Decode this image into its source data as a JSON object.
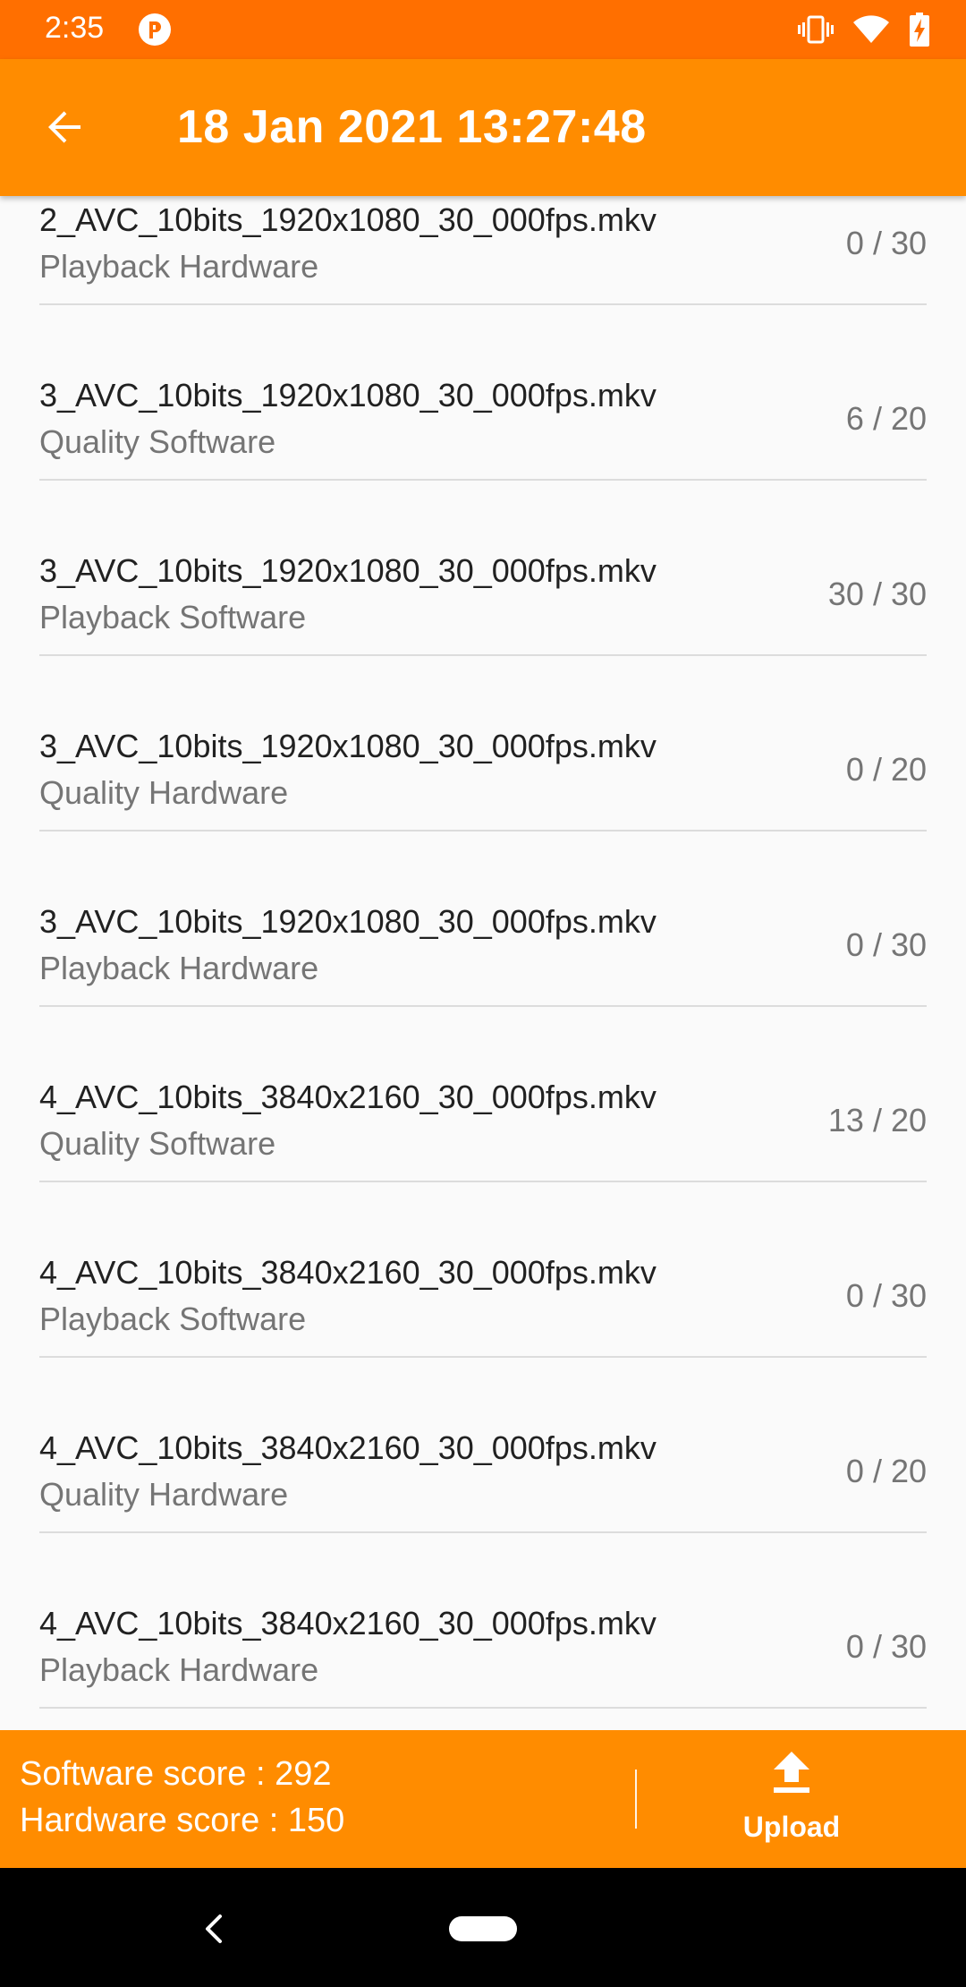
{
  "status_bar": {
    "time": "2:35",
    "icons": [
      "app-notification-icon",
      "vibrate-icon",
      "wifi-icon",
      "battery-charging-icon"
    ]
  },
  "header": {
    "back_icon": "arrow-back-icon",
    "title": "18 Jan 2021 13:27:48"
  },
  "results": [
    {
      "file": "2_AVC_10bits_1920x1080_30_000fps.mkv",
      "type": "Playback Hardware",
      "score": "0 / 30"
    },
    {
      "file": "3_AVC_10bits_1920x1080_30_000fps.mkv",
      "type": "Quality Software",
      "score": "6 / 20"
    },
    {
      "file": "3_AVC_10bits_1920x1080_30_000fps.mkv",
      "type": "Playback Software",
      "score": "30 / 30"
    },
    {
      "file": "3_AVC_10bits_1920x1080_30_000fps.mkv",
      "type": "Quality Hardware",
      "score": "0 / 20"
    },
    {
      "file": "3_AVC_10bits_1920x1080_30_000fps.mkv",
      "type": "Playback Hardware",
      "score": "0 / 30"
    },
    {
      "file": "4_AVC_10bits_3840x2160_30_000fps.mkv",
      "type": "Quality Software",
      "score": "13 / 20"
    },
    {
      "file": "4_AVC_10bits_3840x2160_30_000fps.mkv",
      "type": "Playback Software",
      "score": "0 / 30"
    },
    {
      "file": "4_AVC_10bits_3840x2160_30_000fps.mkv",
      "type": "Quality Hardware",
      "score": "0 / 20"
    },
    {
      "file": "4_AVC_10bits_3840x2160_30_000fps.mkv",
      "type": "Playback Hardware",
      "score": "0 / 30"
    }
  ],
  "footer": {
    "software_score": "Software score : 292",
    "hardware_score": "Hardware score : 150",
    "upload_label": "Upload",
    "upload_icon": "upload-icon"
  },
  "nav_bar": {
    "icons": [
      "nav-back-icon",
      "nav-home-pill"
    ]
  },
  "colors": {
    "status_bar": "#ff6f00",
    "accent": "#ff8c00",
    "primary_text": "#212121",
    "secondary_text": "#757575",
    "divider": "#dcdcdc",
    "background": "#fafafa"
  }
}
